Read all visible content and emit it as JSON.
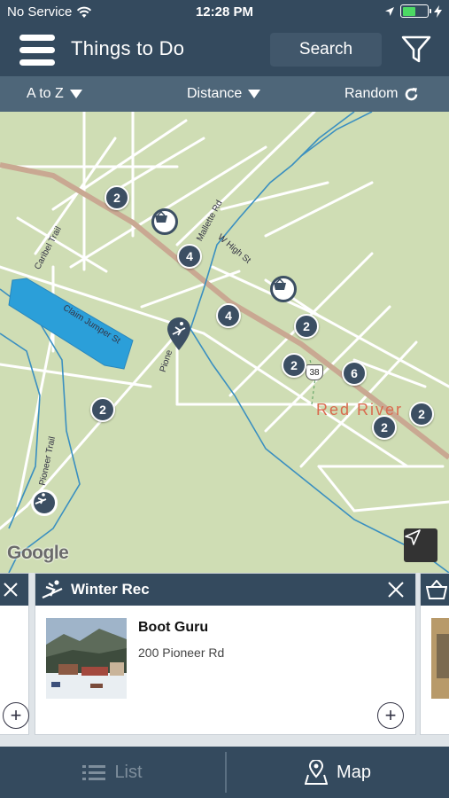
{
  "status_bar": {
    "carrier": "No Service",
    "time": "12:28 PM"
  },
  "header": {
    "title": "Things to Do",
    "search_label": "Search"
  },
  "sort_bar": {
    "a_to_z": "A to Z",
    "distance": "Distance",
    "random": "Random"
  },
  "map": {
    "clusters": [
      "2",
      "4",
      "4",
      "2",
      "2",
      "6",
      "2",
      "2",
      "2"
    ],
    "street_labels": [
      "Caribel Trail",
      "Mallette Rd",
      "W High St",
      "Claim Jumper St",
      "Pione",
      "Pioneer Trail"
    ],
    "route_shield": "38",
    "town_label": "Red River",
    "google_logo": "Google"
  },
  "carousel": {
    "main_card": {
      "category": "Winter Rec",
      "business_name": "Boot Guru",
      "address": "200 Pioneer Rd"
    }
  },
  "tab_bar": {
    "list_label": "List",
    "map_label": "Map"
  },
  "colors": {
    "header": "#344a5e",
    "sort_bar": "#4e6679",
    "map_land": "#cfddb4",
    "water": "#2b9fd9",
    "stream": "#3a8fc0",
    "highway": "#c9a892",
    "marker": "#3c4f63",
    "town_label": "#d96a4e"
  }
}
